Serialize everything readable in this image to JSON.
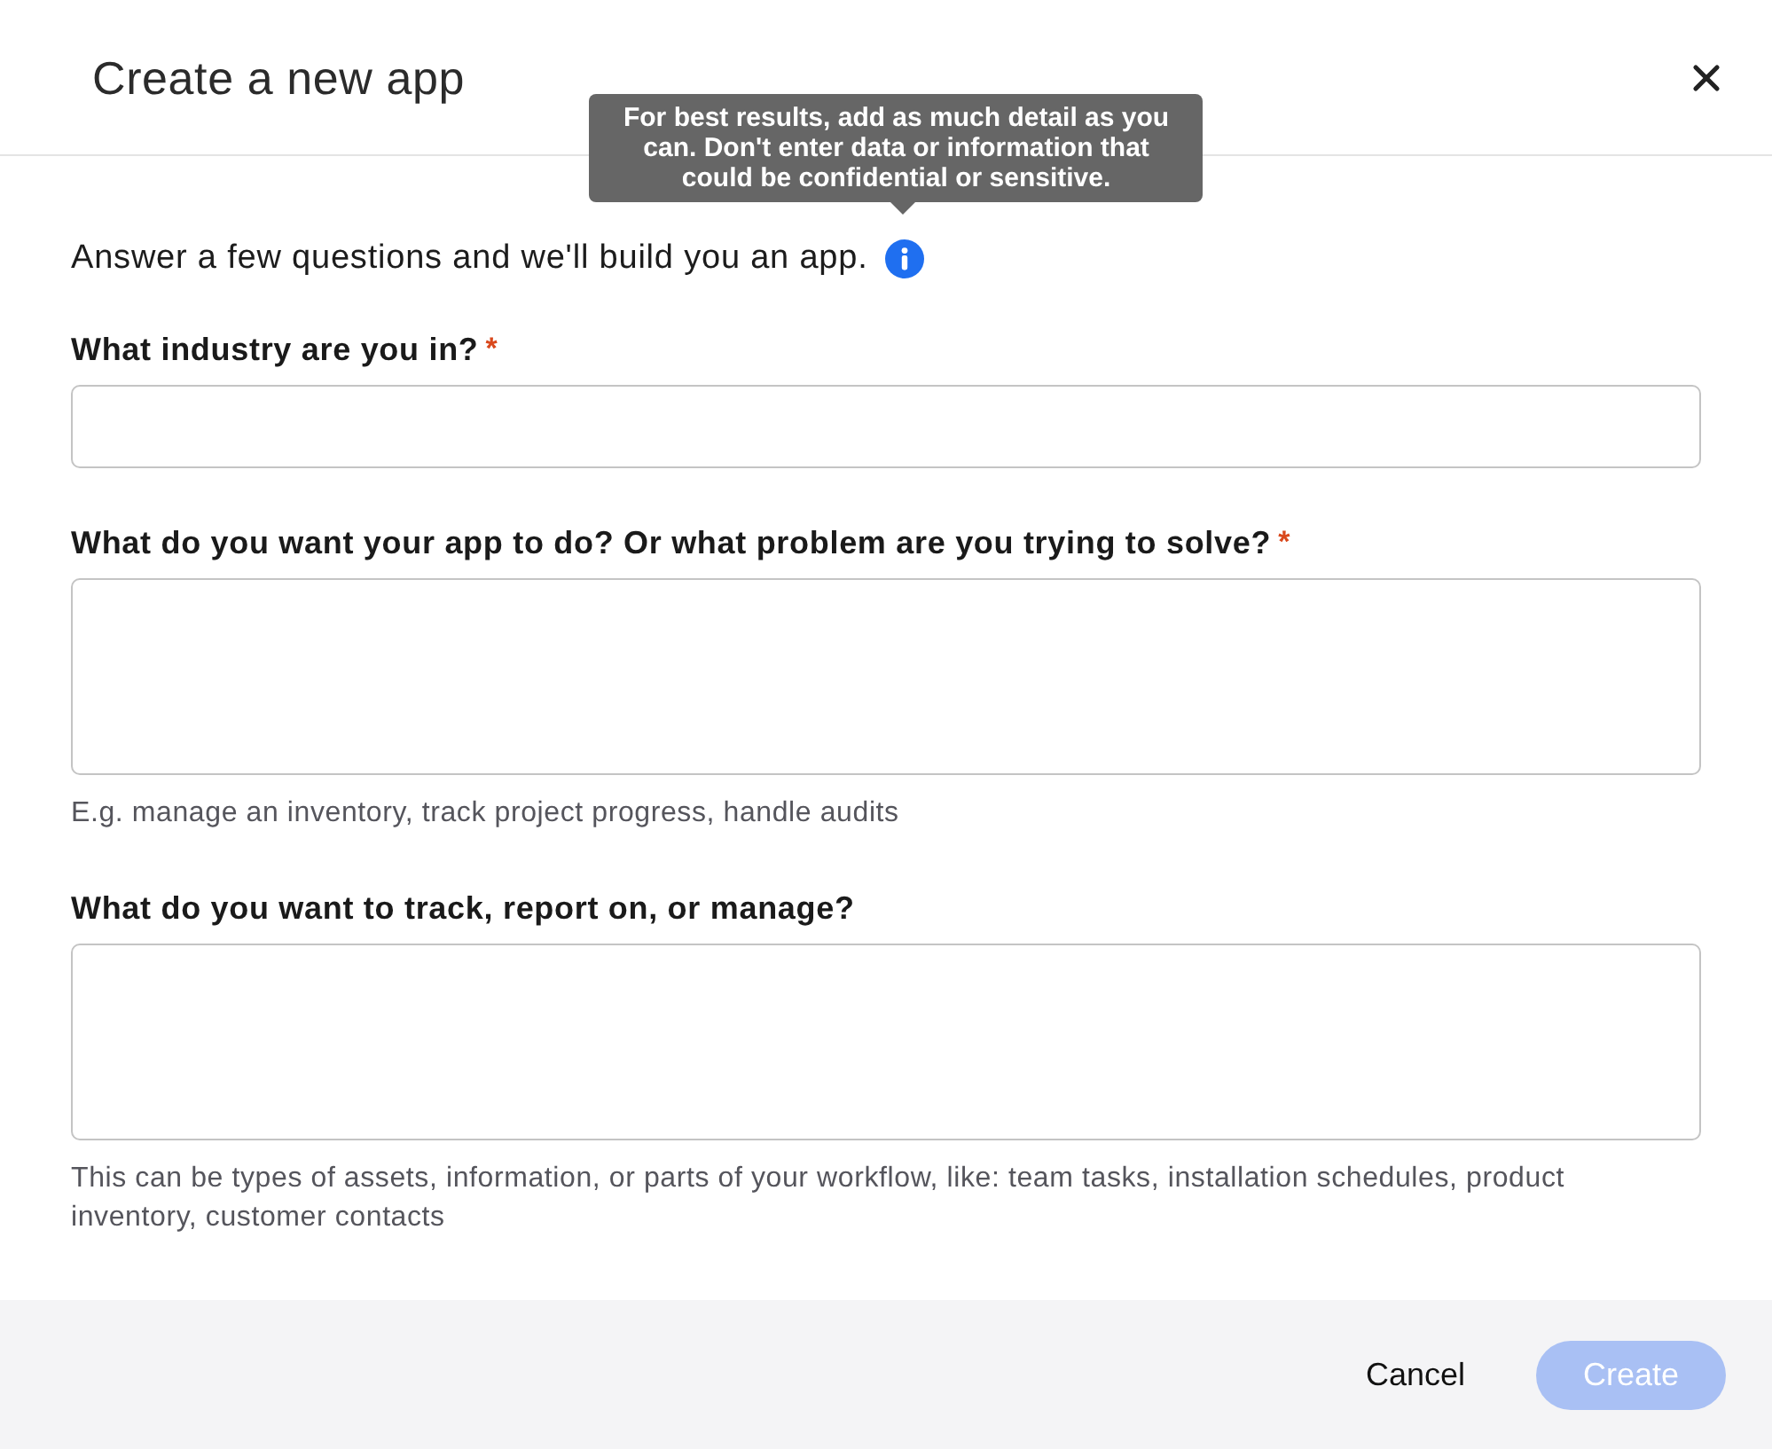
{
  "dialog": {
    "title": "Create a new app",
    "tooltip": "For best results, add as much detail as you can. Don't enter data or information that could be confidential or sensitive.",
    "intro": "Answer a few questions and we'll build you an app.",
    "questions": [
      {
        "label": "What industry are you in?",
        "required_mark": "*",
        "kind": "input"
      },
      {
        "label": "What do you want your app to do? Or what problem are you trying to solve?",
        "required_mark": "*",
        "kind": "textarea",
        "hint": "E.g. manage an inventory, track project progress, handle audits"
      },
      {
        "label": "What do you want to track, report on, or manage?",
        "kind": "textarea",
        "hint": "This can be types of assets, information, or parts of your workflow, like: team tasks, installation schedules, product inventory, customer contacts"
      }
    ],
    "buttons": [
      {
        "label": "Cancel",
        "kind": "secondary",
        "disabled": false
      },
      {
        "label": "Create",
        "kind": "primary",
        "disabled": true
      }
    ]
  }
}
